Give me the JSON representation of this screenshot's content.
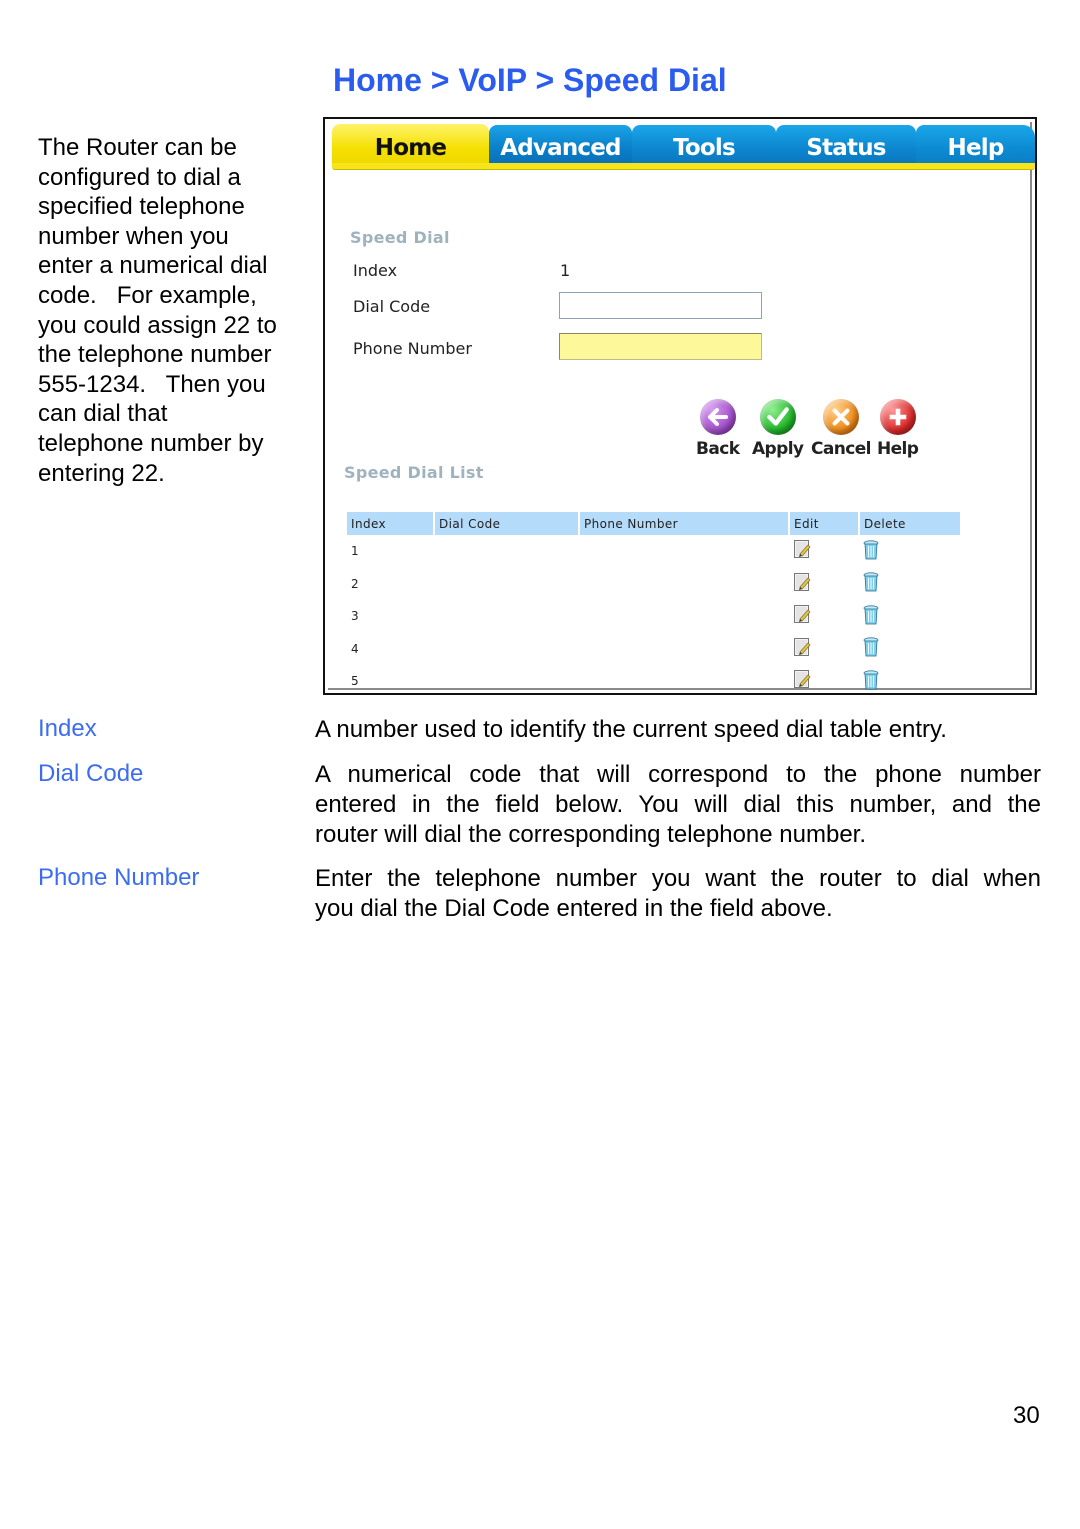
{
  "heading": "Home > VoIP > Speed Dial",
  "intro_lines": [
    "The Router can be",
    "configured to dial a",
    "specified telephone",
    "number when you",
    "enter a numerical dial",
    "code.   For example,",
    "you could assign 22 to",
    "the telephone number",
    "555-1234.   Then you",
    "can dial that",
    "telephone number by",
    "entering 22."
  ],
  "router_ui": {
    "tabs": [
      {
        "label": "Home",
        "active": true
      },
      {
        "label": "Advanced",
        "active": false
      },
      {
        "label": "Tools",
        "active": false
      },
      {
        "label": "Status",
        "active": false
      },
      {
        "label": "Help",
        "active": false
      }
    ],
    "speed_dial": {
      "title": "Speed Dial",
      "index_label": "Index",
      "index_value": "1",
      "dial_code_label": "Dial Code",
      "dial_code_value": "",
      "phone_number_label": "Phone Number",
      "phone_number_value": ""
    },
    "actions": [
      {
        "label": "Back",
        "icon": "back-arrow-icon",
        "color": "#a24fc9"
      },
      {
        "label": "Apply",
        "icon": "checkmark-icon",
        "color": "#22b52a"
      },
      {
        "label": "Cancel",
        "icon": "x-icon",
        "color": "#ee8a1a"
      },
      {
        "label": "Help",
        "icon": "plus-icon",
        "color": "#d92a2a"
      }
    ],
    "list": {
      "title": "Speed Dial List",
      "columns": [
        "Index",
        "Dial Code",
        "Phone Number",
        "Edit",
        "Delete"
      ],
      "rows": [
        {
          "index": "1",
          "dial_code": "",
          "phone_number": ""
        },
        {
          "index": "2",
          "dial_code": "",
          "phone_number": ""
        },
        {
          "index": "3",
          "dial_code": "",
          "phone_number": ""
        },
        {
          "index": "4",
          "dial_code": "",
          "phone_number": ""
        },
        {
          "index": "5",
          "dial_code": "",
          "phone_number": ""
        }
      ]
    }
  },
  "definitions": [
    {
      "term": "Index",
      "lines": [
        "A number used to identify the current speed dial table entry."
      ]
    },
    {
      "term": "Dial Code",
      "lines": [
        "A numerical code that will correspond to the phone number",
        "entered in the field below. You will dial this number, and the",
        "router will dial the corresponding telephone number."
      ]
    },
    {
      "term": "Phone Number",
      "lines": [
        "Enter the telephone number you want the router to dial when",
        "you dial the Dial Code entered in the field above."
      ]
    }
  ],
  "page_number": "30",
  "colors": {
    "heading_blue": "#2a5cf0",
    "term_blue": "#3c6df0",
    "tab_yellow": "#f4e000",
    "tab_blue": "#0a7fc8",
    "table_header": "#b5dbfb",
    "phone_field_yellow": "#fdf99a"
  }
}
